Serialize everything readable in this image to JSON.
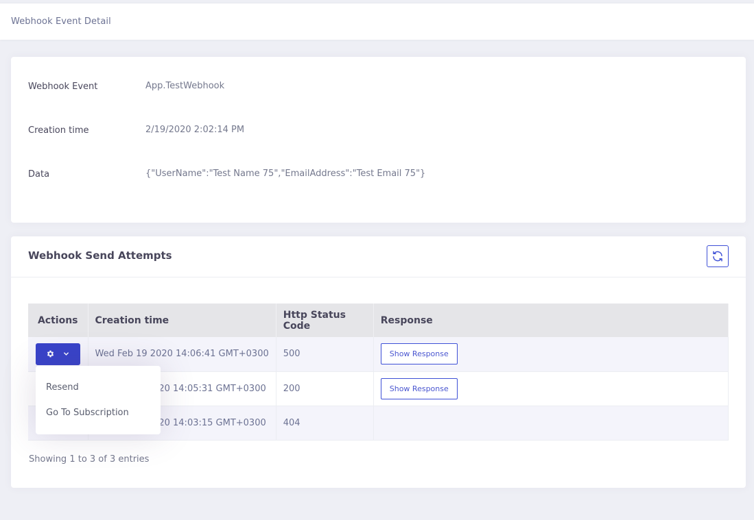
{
  "page": {
    "title": "Webhook Event Detail"
  },
  "event": {
    "rows": [
      {
        "label": "Webhook Event",
        "value": "App.TestWebhook"
      },
      {
        "label": "Creation time",
        "value": "2/19/2020 2:02:14 PM"
      },
      {
        "label": "Data",
        "value": "{\"UserName\":\"Test Name 75\",\"EmailAddress\":\"Test Email 75\"}"
      }
    ]
  },
  "attempts": {
    "title": "Webhook Send Attempts",
    "refresh_icon": "refresh-icon",
    "columns": [
      "Actions",
      "Creation time",
      "Http Status Code",
      "Response"
    ],
    "rows": [
      {
        "time": "Wed Feb 19 2020 14:06:41 GMT+0300",
        "status": "500",
        "response": "Show Response"
      },
      {
        "time": "20 14:05:31 GMT+0300",
        "status": "200",
        "response": "Show Response"
      },
      {
        "time": "20 14:03:15 GMT+0300",
        "status": "404",
        "response": ""
      }
    ],
    "footer": "Showing 1 to 3 of 3 entries"
  },
  "dropdown": {
    "items": [
      "Resend",
      "Go To Subscription"
    ]
  },
  "colors": {
    "primary": "#3843c9",
    "background": "#eeeff5"
  }
}
